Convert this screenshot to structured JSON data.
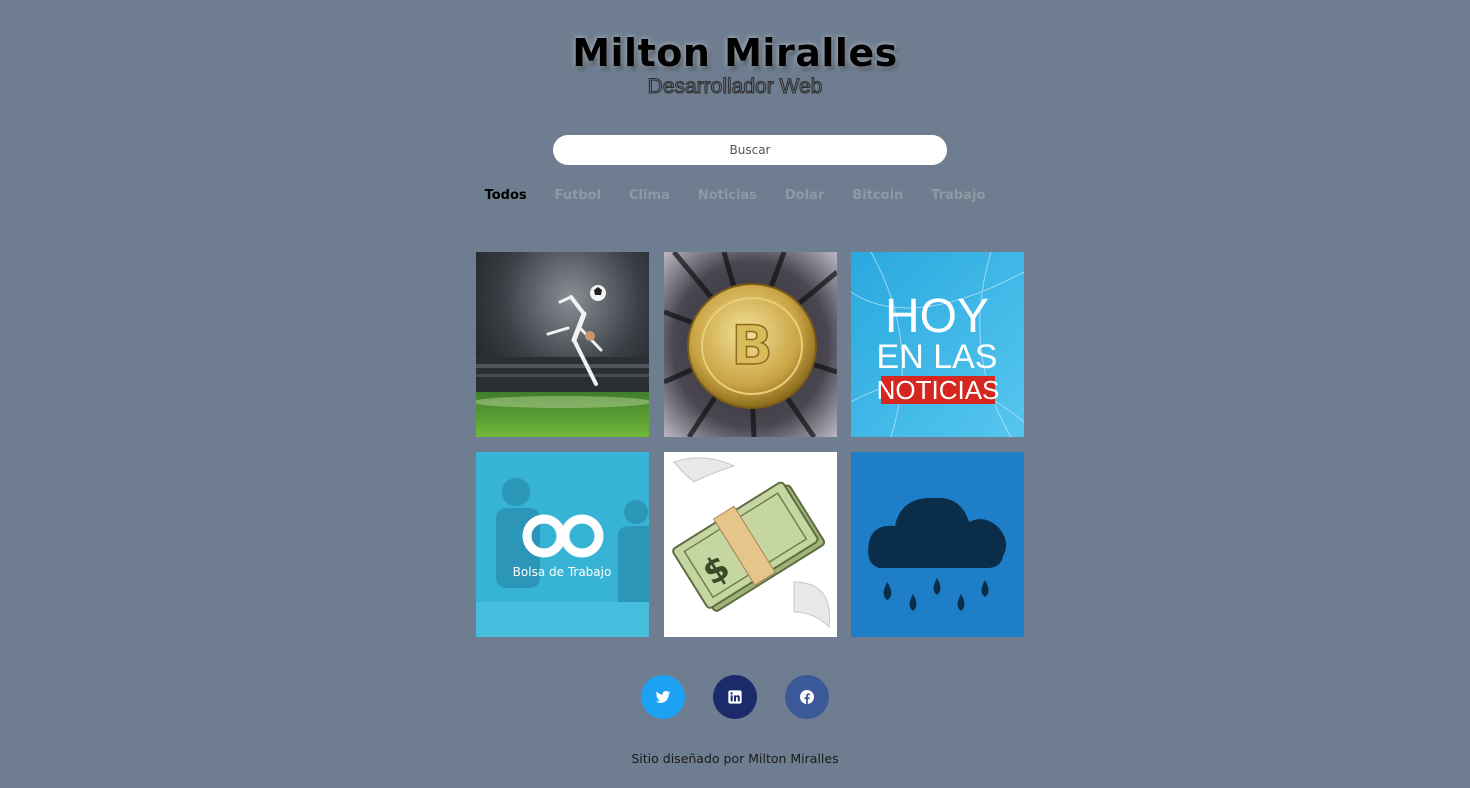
{
  "header": {
    "title": "Milton Miralles",
    "subtitle": "Desarrollador Web"
  },
  "search": {
    "placeholder": "Buscar"
  },
  "filters": [
    {
      "label": "Todos",
      "active": true
    },
    {
      "label": "Futbol",
      "active": false
    },
    {
      "label": "Clima",
      "active": false
    },
    {
      "label": "Noticias",
      "active": false
    },
    {
      "label": "Dolar",
      "active": false
    },
    {
      "label": "Bitcoin",
      "active": false
    },
    {
      "label": "Trabajo",
      "active": false
    }
  ],
  "tiles": [
    {
      "icon": "soccer-player-image"
    },
    {
      "icon": "bitcoin-coin-image"
    },
    {
      "icon": "news-image",
      "lines": [
        "HOY",
        "EN LAS",
        "NOTICIAS"
      ]
    },
    {
      "icon": "job-board-image",
      "caption": "Bolsa de Trabajo"
    },
    {
      "icon": "flying-money-image",
      "symbol": "$"
    },
    {
      "icon": "rain-cloud-image"
    }
  ],
  "social": [
    {
      "icon": "twitter-icon",
      "color": "#1da1f2"
    },
    {
      "icon": "linkedin-icon",
      "color": "#1b2a6b"
    },
    {
      "icon": "facebook-icon",
      "color": "#3b5998"
    }
  ],
  "footer": {
    "text": "Sitio diseñado por Milton Miralles"
  },
  "colors": {
    "background": "#6e7d8f",
    "filter_inactive": "#8f99a4",
    "filter_active": "#000000"
  }
}
